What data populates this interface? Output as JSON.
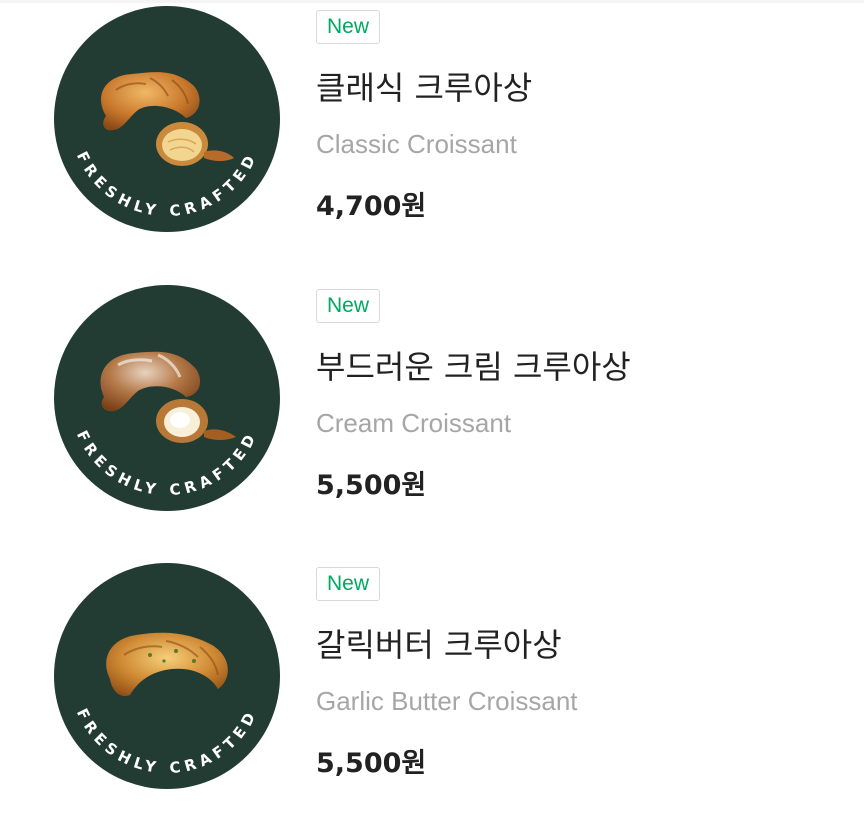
{
  "colors": {
    "circle_bg": "#233c33",
    "badge_text": "#00a862",
    "name_ko": "#222222",
    "name_en": "#a6a6a6",
    "price": "#222222"
  },
  "items": [
    {
      "badge": "New",
      "name_ko": "클래식 크루아상",
      "name_en": "Classic Croissant",
      "price": "4,700원",
      "image_stamp": "FRESHLY CRAFTED",
      "image_subject": "croissant-with-cross-section"
    },
    {
      "badge": "New",
      "name_ko": "부드러운 크림 크루아상",
      "name_en": "Cream Croissant",
      "price": "5,500원",
      "image_stamp": "FRESHLY CRAFTED",
      "image_subject": "powdered-croissant-with-cream-filling"
    },
    {
      "badge": "New",
      "name_ko": "갈릭버터 크루아상",
      "name_en": "Garlic Butter Croissant",
      "price": "5,500원",
      "image_stamp": "FRESHLY CRAFTED",
      "image_subject": "garlic-butter-croissant"
    }
  ]
}
